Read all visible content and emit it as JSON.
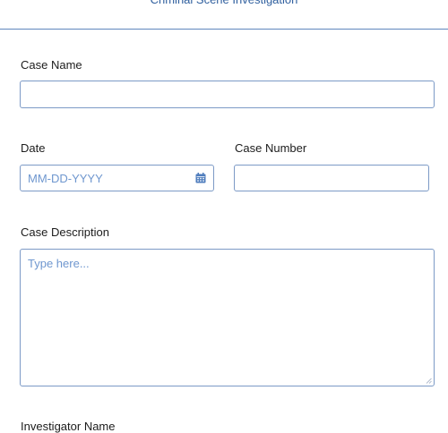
{
  "header": {
    "title": "Criminal Scene Investigation"
  },
  "form": {
    "case_name": {
      "label": "Case Name",
      "value": ""
    },
    "date": {
      "label": "Date",
      "placeholder": "MM-DD-YYYY",
      "value": "",
      "icon": "calendar-icon"
    },
    "case_number": {
      "label": "Case Number",
      "value": ""
    },
    "case_description": {
      "label": "Case Description",
      "placeholder": "Type here...",
      "value": ""
    },
    "investigator_name": {
      "label": "Investigator Name"
    }
  },
  "colors": {
    "accent": "#2f5f9e",
    "border": "#7c9ac6",
    "placeholder": "#6f97cf"
  }
}
